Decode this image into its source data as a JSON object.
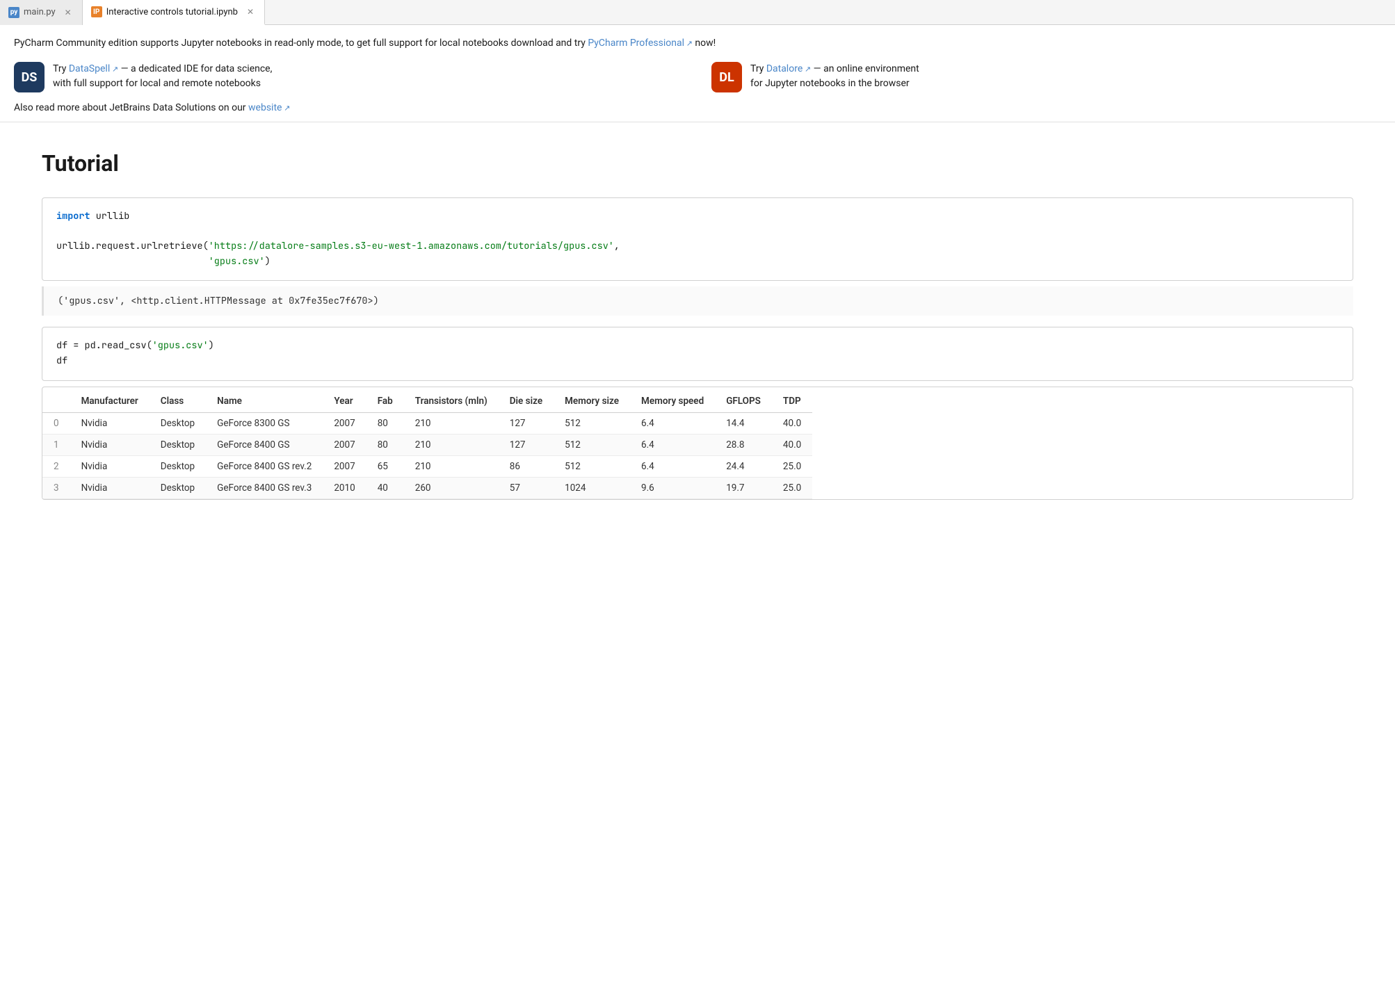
{
  "tabs": [
    {
      "id": "main-py",
      "label": "main.py",
      "icon_type": "py",
      "icon_text": "py",
      "active": false,
      "closable": true
    },
    {
      "id": "interactive-ipynb",
      "label": "Interactive controls tutorial.ipynb",
      "icon_type": "ipynb",
      "icon_text": "IP",
      "active": true,
      "closable": true
    }
  ],
  "banner": {
    "top_text_before": "PyCharm Community edition supports Jupyter notebooks in read-only mode, to get full support for local notebooks download and try ",
    "top_link_text": "PyCharm Professional",
    "top_text_middle": " now!",
    "cards": [
      {
        "id": "dataspell",
        "icon_label": "DS",
        "icon_color": "ds",
        "link_text": "DataSpell",
        "text_before": "Try ",
        "text_after": " — a dedicated IDE for data science, with full support for local and remote notebooks"
      },
      {
        "id": "datalore",
        "icon_label": "DL",
        "icon_color": "dl",
        "link_text": "Datalore",
        "text_before": "Try ",
        "text_after": " — an online environment for Jupyter notebooks in the browser"
      }
    ],
    "footer_before": "Also read more about JetBrains Data Solutions on our ",
    "footer_link_text": "website",
    "footer_after": ""
  },
  "notebook": {
    "title": "Tutorial",
    "cells": [
      {
        "type": "code",
        "id": "cell-1",
        "lines": [
          {
            "parts": [
              {
                "type": "kw",
                "text": "import"
              },
              {
                "type": "plain",
                "text": " urllib"
              }
            ]
          },
          {
            "parts": []
          },
          {
            "parts": [
              {
                "type": "plain",
                "text": "urllib.request.urlretrieve("
              },
              {
                "type": "str",
                "text": "'https://datalore-samples.s3-eu-west-1.amazonaws.com/tutorials/gpus.csv'"
              },
              {
                "type": "plain",
                "text": ","
              }
            ]
          },
          {
            "parts": [
              {
                "type": "plain",
                "text": "                           "
              },
              {
                "type": "str",
                "text": "'gpus.csv'"
              },
              {
                "type": "plain",
                "text": ")"
              }
            ]
          }
        ]
      },
      {
        "type": "output",
        "id": "output-1",
        "text": "('gpus.csv', <http.client.HTTPMessage at 0x7fe35ec7f670>)"
      },
      {
        "type": "code",
        "id": "cell-2",
        "lines": [
          {
            "parts": [
              {
                "type": "plain",
                "text": "df = pd.read_csv("
              },
              {
                "type": "str",
                "text": "'gpus.csv'"
              },
              {
                "type": "plain",
                "text": ")"
              }
            ]
          },
          {
            "parts": [
              {
                "type": "plain",
                "text": "df"
              }
            ]
          }
        ]
      }
    ],
    "table": {
      "columns": [
        "",
        "Manufacturer",
        "Class",
        "Name",
        "Year",
        "Fab",
        "Transistors (mln)",
        "Die size",
        "Memory size",
        "Memory speed",
        "GFLOPS",
        "TDP"
      ],
      "rows": [
        [
          "0",
          "Nvidia",
          "Desktop",
          "GeForce 8300 GS",
          "2007",
          "80",
          "210",
          "127",
          "512",
          "6.4",
          "14.4",
          "40.0"
        ],
        [
          "1",
          "Nvidia",
          "Desktop",
          "GeForce 8400 GS",
          "2007",
          "80",
          "210",
          "127",
          "512",
          "6.4",
          "28.8",
          "40.0"
        ],
        [
          "2",
          "Nvidia",
          "Desktop",
          "GeForce 8400 GS rev.2",
          "2007",
          "65",
          "210",
          "86",
          "512",
          "6.4",
          "24.4",
          "25.0"
        ],
        [
          "3",
          "Nvidia",
          "Desktop",
          "GeForce 8400 GS rev.3",
          "2010",
          "40",
          "260",
          "57",
          "1024",
          "9.6",
          "19.7",
          "25.0"
        ]
      ]
    }
  }
}
